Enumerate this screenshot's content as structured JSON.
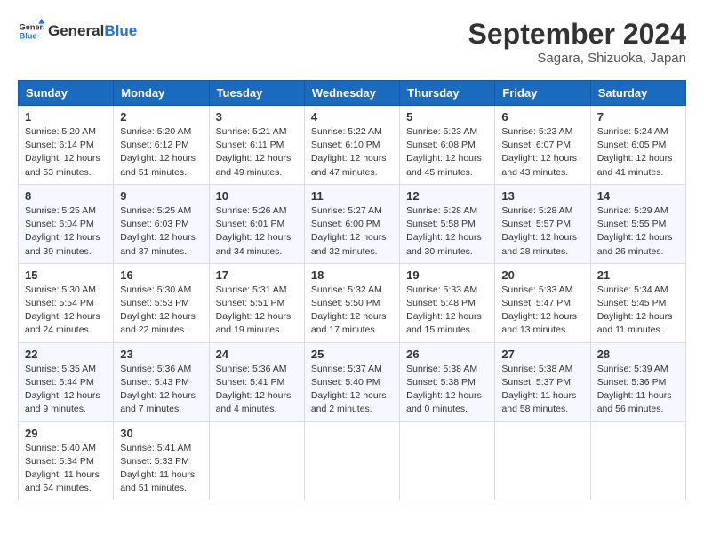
{
  "header": {
    "logo_line1": "General",
    "logo_line2": "Blue",
    "month_title": "September 2024",
    "location": "Sagara, Shizuoka, Japan"
  },
  "weekdays": [
    "Sunday",
    "Monday",
    "Tuesday",
    "Wednesday",
    "Thursday",
    "Friday",
    "Saturday"
  ],
  "weeks": [
    [
      {
        "day": "1",
        "info": "Sunrise: 5:20 AM\nSunset: 6:14 PM\nDaylight: 12 hours\nand 53 minutes."
      },
      {
        "day": "2",
        "info": "Sunrise: 5:20 AM\nSunset: 6:12 PM\nDaylight: 12 hours\nand 51 minutes."
      },
      {
        "day": "3",
        "info": "Sunrise: 5:21 AM\nSunset: 6:11 PM\nDaylight: 12 hours\nand 49 minutes."
      },
      {
        "day": "4",
        "info": "Sunrise: 5:22 AM\nSunset: 6:10 PM\nDaylight: 12 hours\nand 47 minutes."
      },
      {
        "day": "5",
        "info": "Sunrise: 5:23 AM\nSunset: 6:08 PM\nDaylight: 12 hours\nand 45 minutes."
      },
      {
        "day": "6",
        "info": "Sunrise: 5:23 AM\nSunset: 6:07 PM\nDaylight: 12 hours\nand 43 minutes."
      },
      {
        "day": "7",
        "info": "Sunrise: 5:24 AM\nSunset: 6:05 PM\nDaylight: 12 hours\nand 41 minutes."
      }
    ],
    [
      {
        "day": "8",
        "info": "Sunrise: 5:25 AM\nSunset: 6:04 PM\nDaylight: 12 hours\nand 39 minutes."
      },
      {
        "day": "9",
        "info": "Sunrise: 5:25 AM\nSunset: 6:03 PM\nDaylight: 12 hours\nand 37 minutes."
      },
      {
        "day": "10",
        "info": "Sunrise: 5:26 AM\nSunset: 6:01 PM\nDaylight: 12 hours\nand 34 minutes."
      },
      {
        "day": "11",
        "info": "Sunrise: 5:27 AM\nSunset: 6:00 PM\nDaylight: 12 hours\nand 32 minutes."
      },
      {
        "day": "12",
        "info": "Sunrise: 5:28 AM\nSunset: 5:58 PM\nDaylight: 12 hours\nand 30 minutes."
      },
      {
        "day": "13",
        "info": "Sunrise: 5:28 AM\nSunset: 5:57 PM\nDaylight: 12 hours\nand 28 minutes."
      },
      {
        "day": "14",
        "info": "Sunrise: 5:29 AM\nSunset: 5:55 PM\nDaylight: 12 hours\nand 26 minutes."
      }
    ],
    [
      {
        "day": "15",
        "info": "Sunrise: 5:30 AM\nSunset: 5:54 PM\nDaylight: 12 hours\nand 24 minutes."
      },
      {
        "day": "16",
        "info": "Sunrise: 5:30 AM\nSunset: 5:53 PM\nDaylight: 12 hours\nand 22 minutes."
      },
      {
        "day": "17",
        "info": "Sunrise: 5:31 AM\nSunset: 5:51 PM\nDaylight: 12 hours\nand 19 minutes."
      },
      {
        "day": "18",
        "info": "Sunrise: 5:32 AM\nSunset: 5:50 PM\nDaylight: 12 hours\nand 17 minutes."
      },
      {
        "day": "19",
        "info": "Sunrise: 5:33 AM\nSunset: 5:48 PM\nDaylight: 12 hours\nand 15 minutes."
      },
      {
        "day": "20",
        "info": "Sunrise: 5:33 AM\nSunset: 5:47 PM\nDaylight: 12 hours\nand 13 minutes."
      },
      {
        "day": "21",
        "info": "Sunrise: 5:34 AM\nSunset: 5:45 PM\nDaylight: 12 hours\nand 11 minutes."
      }
    ],
    [
      {
        "day": "22",
        "info": "Sunrise: 5:35 AM\nSunset: 5:44 PM\nDaylight: 12 hours\nand 9 minutes."
      },
      {
        "day": "23",
        "info": "Sunrise: 5:36 AM\nSunset: 5:43 PM\nDaylight: 12 hours\nand 7 minutes."
      },
      {
        "day": "24",
        "info": "Sunrise: 5:36 AM\nSunset: 5:41 PM\nDaylight: 12 hours\nand 4 minutes."
      },
      {
        "day": "25",
        "info": "Sunrise: 5:37 AM\nSunset: 5:40 PM\nDaylight: 12 hours\nand 2 minutes."
      },
      {
        "day": "26",
        "info": "Sunrise: 5:38 AM\nSunset: 5:38 PM\nDaylight: 12 hours\nand 0 minutes."
      },
      {
        "day": "27",
        "info": "Sunrise: 5:38 AM\nSunset: 5:37 PM\nDaylight: 11 hours\nand 58 minutes."
      },
      {
        "day": "28",
        "info": "Sunrise: 5:39 AM\nSunset: 5:36 PM\nDaylight: 11 hours\nand 56 minutes."
      }
    ],
    [
      {
        "day": "29",
        "info": "Sunrise: 5:40 AM\nSunset: 5:34 PM\nDaylight: 11 hours\nand 54 minutes."
      },
      {
        "day": "30",
        "info": "Sunrise: 5:41 AM\nSunset: 5:33 PM\nDaylight: 11 hours\nand 51 minutes."
      },
      {
        "day": "",
        "info": ""
      },
      {
        "day": "",
        "info": ""
      },
      {
        "day": "",
        "info": ""
      },
      {
        "day": "",
        "info": ""
      },
      {
        "day": "",
        "info": ""
      }
    ]
  ]
}
